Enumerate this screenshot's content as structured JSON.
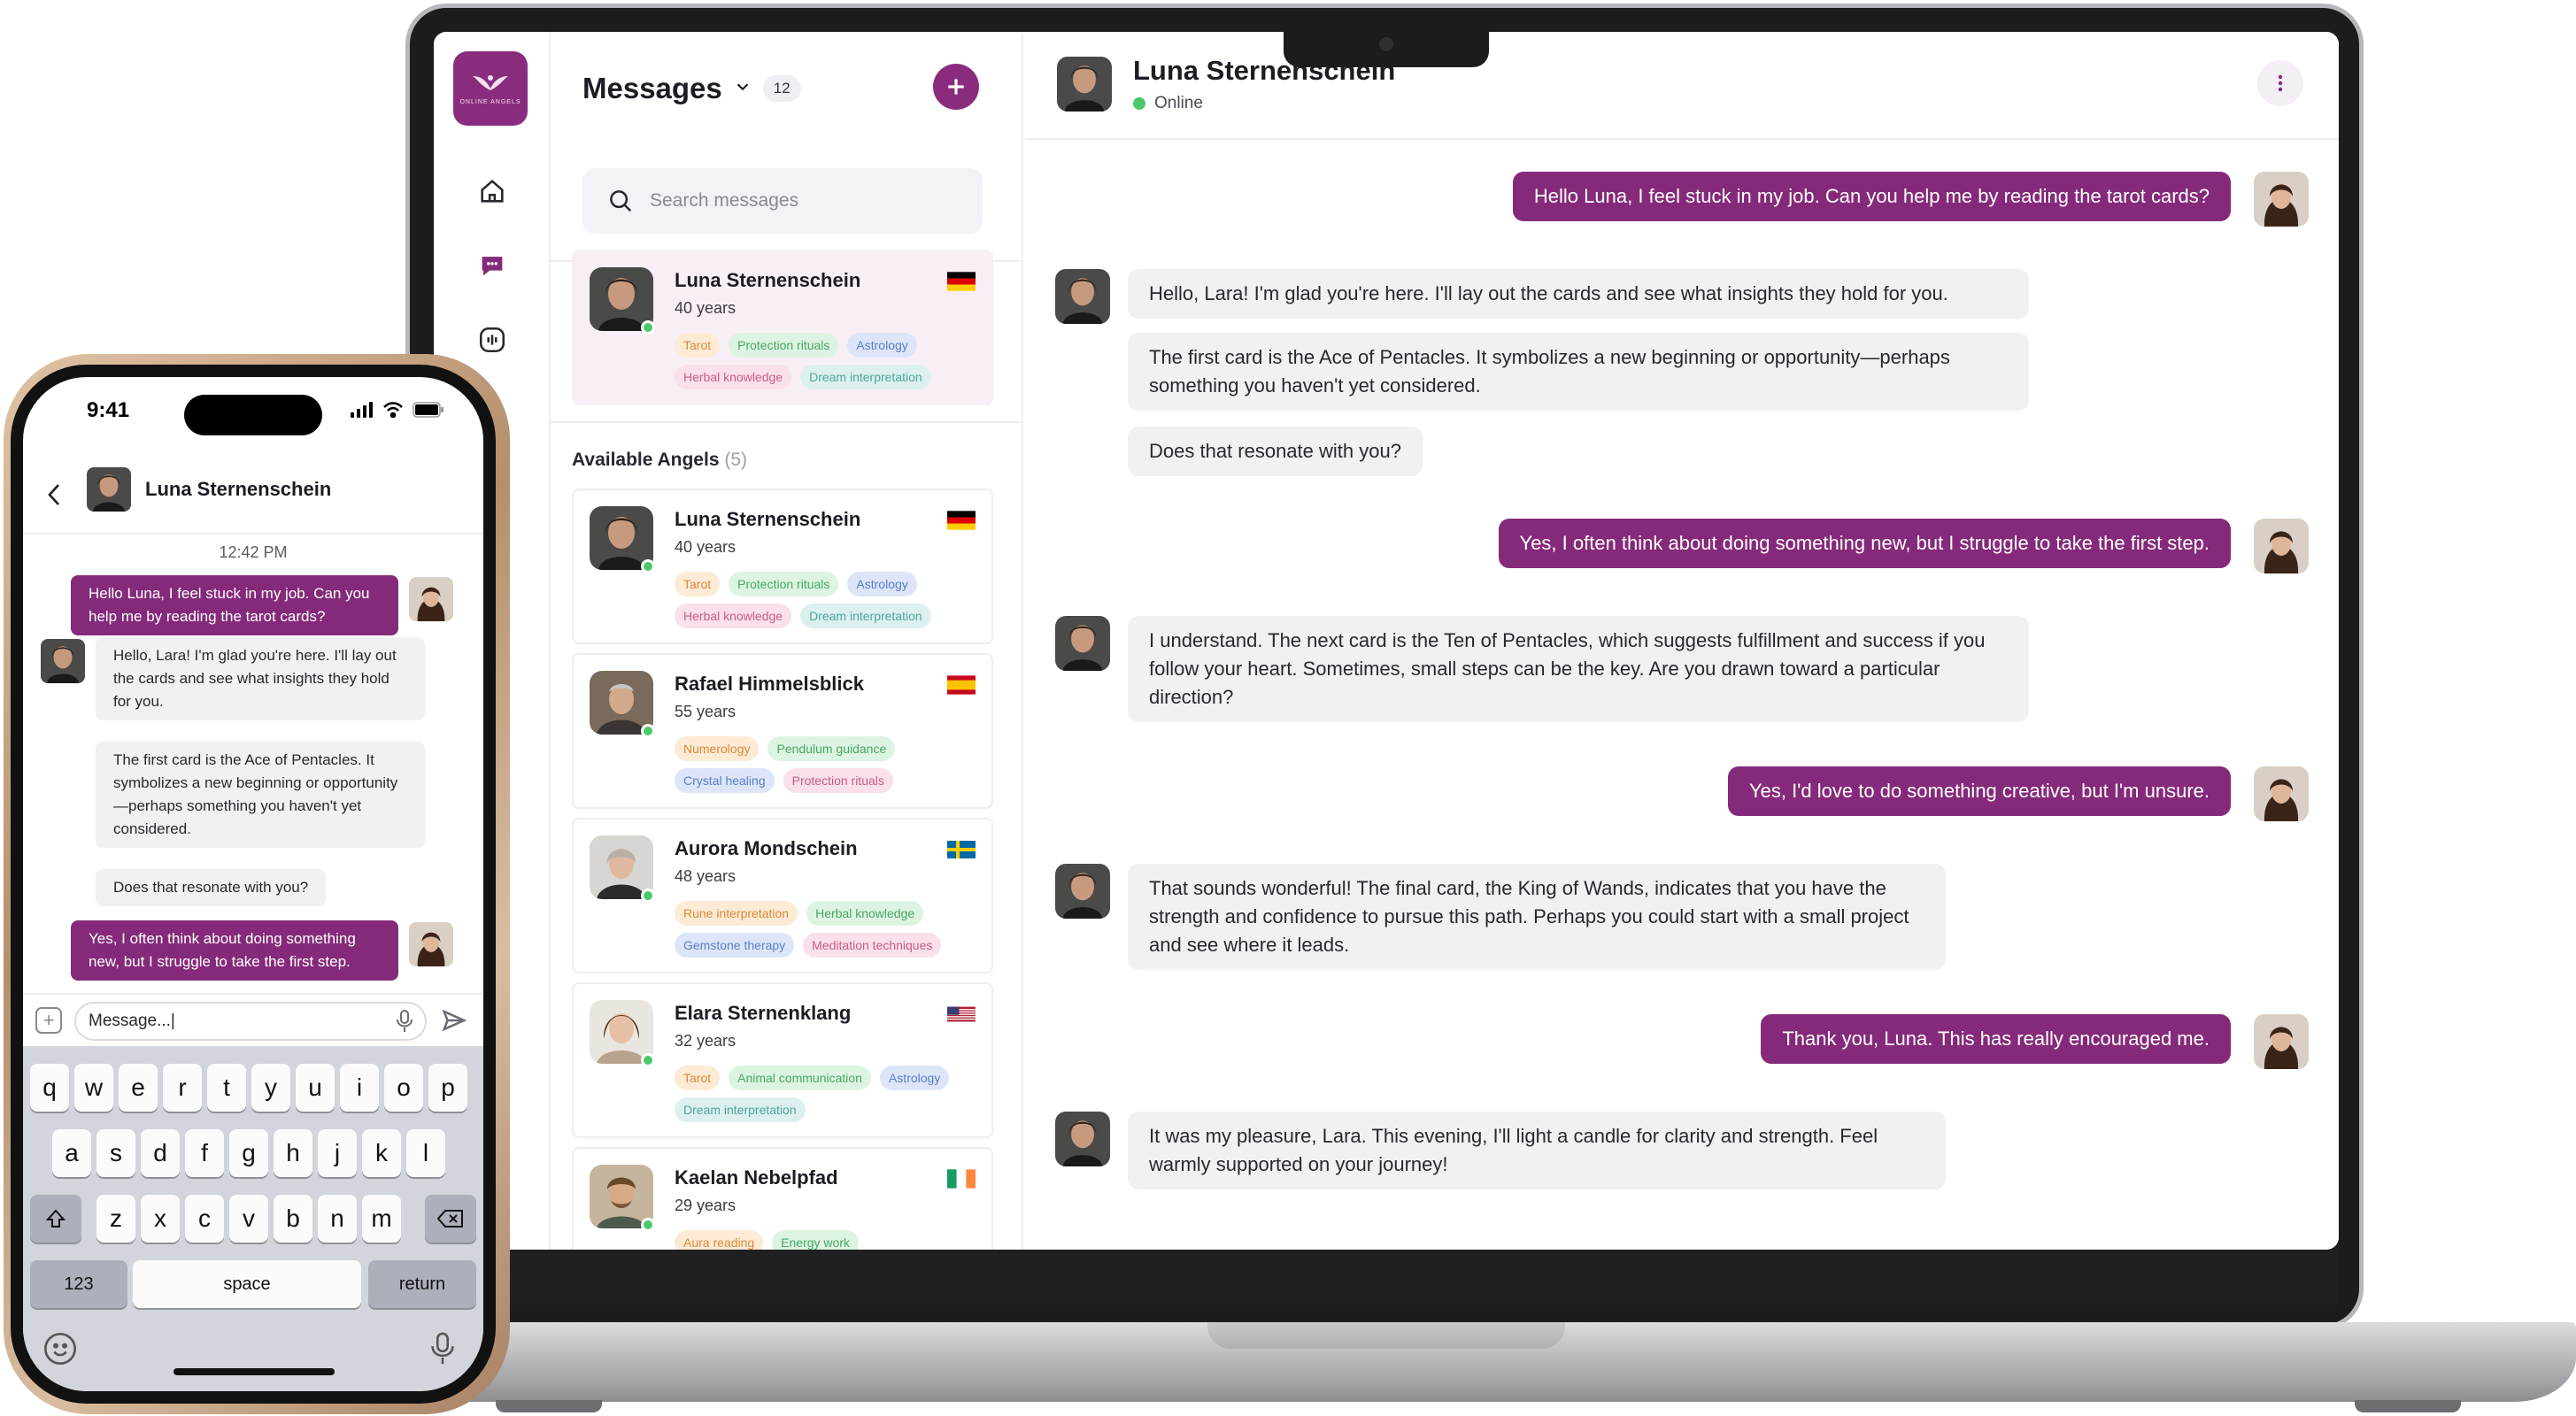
{
  "laptop": {
    "logo": {
      "brand": "ONLINE ANGELS",
      "icon": "angel-wings-icon"
    },
    "rail_icons": [
      "home-icon",
      "chat-icon",
      "podcast-icon"
    ],
    "list": {
      "title": "Messages",
      "unread_count": "12",
      "search_placeholder": "Search messages",
      "section_label": "Available Angels",
      "section_count": "(5)",
      "active_conversation": {
        "name": "Luna Sternenschein",
        "age": "40 years",
        "flag": "DE",
        "tags": [
          {
            "label": "Tarot",
            "color": "orange"
          },
          {
            "label": "Protection rituals",
            "color": "green"
          },
          {
            "label": "Astrology",
            "color": "blue"
          },
          {
            "label": "Herbal knowledge",
            "color": "pink"
          },
          {
            "label": "Dream interpretation",
            "color": "teal"
          }
        ]
      },
      "angels": [
        {
          "name": "Luna Sternenschein",
          "age": "40 years",
          "flag": "DE",
          "tags": [
            {
              "label": "Tarot",
              "color": "orange"
            },
            {
              "label": "Protection rituals",
              "color": "green"
            },
            {
              "label": "Astrology",
              "color": "blue"
            },
            {
              "label": "Herbal knowledge",
              "color": "pink"
            },
            {
              "label": "Dream interpretation",
              "color": "teal"
            }
          ]
        },
        {
          "name": "Rafael Himmelsblick",
          "age": "55 years",
          "flag": "ES",
          "tags": [
            {
              "label": "Numerology",
              "color": "orange"
            },
            {
              "label": "Pendulum guidance",
              "color": "green"
            },
            {
              "label": "Crystal healing",
              "color": "blue"
            },
            {
              "label": "Protection rituals",
              "color": "pink"
            }
          ]
        },
        {
          "name": "Aurora Mondschein",
          "age": "48 years",
          "flag": "SE",
          "tags": [
            {
              "label": "Rune interpretation",
              "color": "orange"
            },
            {
              "label": "Herbal knowledge",
              "color": "green"
            },
            {
              "label": "Gemstone therapy",
              "color": "blue"
            },
            {
              "label": "Meditation techniques",
              "color": "pink"
            }
          ]
        },
        {
          "name": "Elara Sternenklang",
          "age": "32 years",
          "flag": "US",
          "tags": [
            {
              "label": "Tarot",
              "color": "orange"
            },
            {
              "label": "Animal communication",
              "color": "green"
            },
            {
              "label": "Astrology",
              "color": "blue"
            },
            {
              "label": "Dream interpretation",
              "color": "teal"
            }
          ]
        },
        {
          "name": "Kaelan Nebelpfad",
          "age": "29 years",
          "flag": "IE",
          "tags": [
            {
              "label": "Aura reading",
              "color": "orange"
            },
            {
              "label": "Energy work",
              "color": "green"
            }
          ]
        }
      ]
    },
    "chat": {
      "contact_name": "Luna Sternenschein",
      "status": "Online",
      "messages": [
        {
          "from": "user",
          "text": "Hello Luna, I feel stuck in my job. Can you help me by reading the tarot cards?"
        },
        {
          "from": "angel",
          "text": "Hello, Lara! I'm glad you're here. I'll lay out the cards and see what insights they hold for you."
        },
        {
          "from": "angel",
          "text": "The first card is the Ace of Pentacles. It symbolizes a new beginning or opportunity—perhaps something you haven't yet considered."
        },
        {
          "from": "angel",
          "text": "Does that resonate with you?"
        },
        {
          "from": "user",
          "text": "Yes, I often think about doing something new, but I struggle to take the first step."
        },
        {
          "from": "angel",
          "text": "I understand. The next card is the Ten of Pentacles, which suggests fulfillment and success if you follow your heart. Sometimes, small steps can be the key. Are you drawn toward a particular direction?"
        },
        {
          "from": "user",
          "text": "Yes, I'd love to do something creative, but I'm unsure."
        },
        {
          "from": "angel",
          "text": "That sounds wonderful! The final card, the King of Wands, indicates that you have the strength and confidence to pursue this path. Perhaps you could start with a small project and see where it leads."
        },
        {
          "from": "user",
          "text": "Thank you, Luna. This has really encouraged me."
        },
        {
          "from": "angel",
          "text": "It was my pleasure, Lara. This evening, I'll light a candle for clarity and strength. Feel warmly supported on your journey!"
        }
      ]
    }
  },
  "phone": {
    "time": "9:41",
    "contact_name": "Luna Sternenschein",
    "timestamp": "12:42 PM",
    "messages": [
      {
        "from": "user",
        "text": "Hello Luna, I feel stuck in my job. Can you help me by reading the tarot cards?"
      },
      {
        "from": "angel",
        "text": "Hello, Lara! I'm glad you're here. I'll lay out the cards and see what insights they hold for you."
      },
      {
        "from": "angel",
        "text": "The first card is the Ace of Pentacles. It symbolizes a new beginning or opportunity—perhaps something you haven't yet considered."
      },
      {
        "from": "angel",
        "text": "Does that resonate with you?"
      },
      {
        "from": "user",
        "text": "Yes, I often think about doing something new, but I struggle to take the first step."
      }
    ],
    "compose_value": "Message...|",
    "keyboard": {
      "row1": [
        "q",
        "w",
        "e",
        "r",
        "t",
        "y",
        "u",
        "i",
        "o",
        "p"
      ],
      "row2": [
        "a",
        "s",
        "d",
        "f",
        "g",
        "h",
        "j",
        "k",
        "l"
      ],
      "row3": [
        "z",
        "x",
        "c",
        "v",
        "b",
        "n",
        "m"
      ],
      "numbers_key": "123",
      "space_key": "space",
      "return_key": "return"
    }
  },
  "colors": {
    "brand": "#852a7a",
    "online": "#4cc86a",
    "incoming_bubble": "#f1f0f3"
  }
}
